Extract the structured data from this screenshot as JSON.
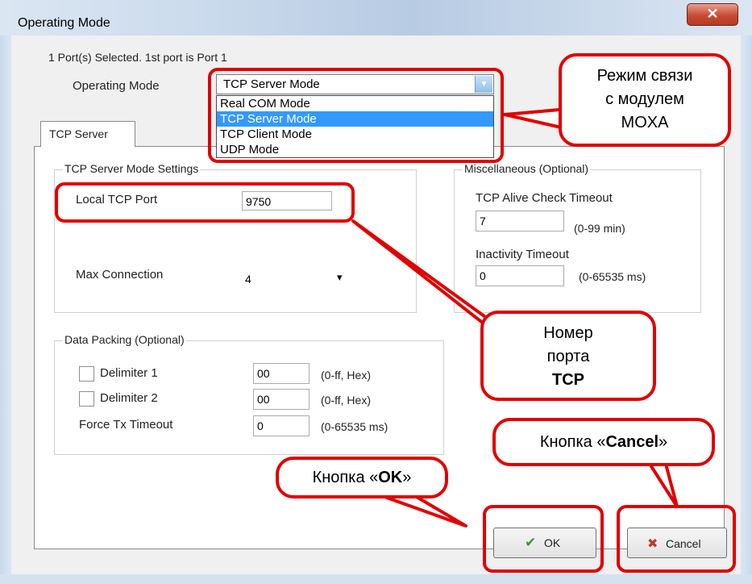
{
  "window": {
    "title": "Operating Mode",
    "close_glyph": "✕"
  },
  "header": {
    "selected_text": "1 Port(s) Selected. 1st port is Port 1",
    "op_mode_label": "Operating Mode"
  },
  "combo": {
    "value": "TCP Server Mode",
    "arrow_glyph": "▼",
    "options": [
      "Real COM Mode",
      "TCP Server Mode",
      "TCP Client Mode",
      "UDP Mode"
    ],
    "selected_index": 1
  },
  "tab": {
    "label": "TCP Server"
  },
  "server_settings": {
    "title": "TCP Server Mode Settings",
    "local_port_label": "Local TCP Port",
    "local_port_value": "9750",
    "max_conn_label": "Max Connection",
    "max_conn_value": "4",
    "dropdown_glyph": "▾"
  },
  "misc": {
    "title": "Miscellaneous (Optional)",
    "alive_label": "TCP Alive Check Timeout",
    "alive_value": "7",
    "alive_hint": "(0-99 min)",
    "inactivity_label": "Inactivity Timeout",
    "inactivity_value": "0",
    "inactivity_hint": "(0-65535 ms)"
  },
  "packing": {
    "title": "Data Packing (Optional)",
    "delim1_label": "Delimiter 1",
    "delim1_value": "00",
    "delim1_hint": "(0-ff, Hex)",
    "delim2_label": "Delimiter 2",
    "delim2_value": "00",
    "delim2_hint": "(0-ff, Hex)",
    "force_label": "Force Tx Timeout",
    "force_value": "0",
    "force_hint": "(0-65535 ms)"
  },
  "buttons": {
    "ok_label": "OK",
    "ok_icon_glyph": "✔",
    "cancel_label": "Cancel",
    "cancel_icon_glyph": "✖"
  },
  "callouts": {
    "mode": [
      "Режим связи",
      "с модулем",
      "MOXA"
    ],
    "port": [
      "Номер",
      "порта",
      "TCP"
    ],
    "ok_prefix": "Кнопка «",
    "ok_bold": "OK",
    "ok_suffix": "»",
    "cancel_prefix": "Кнопка «",
    "cancel_bold": "Cancel",
    "cancel_suffix": "»"
  },
  "colors": {
    "accent_red": "#e00000",
    "selection_blue": "#3399ff",
    "ok_icon": "#3a9a2a",
    "cancel_icon": "#c0392b"
  }
}
